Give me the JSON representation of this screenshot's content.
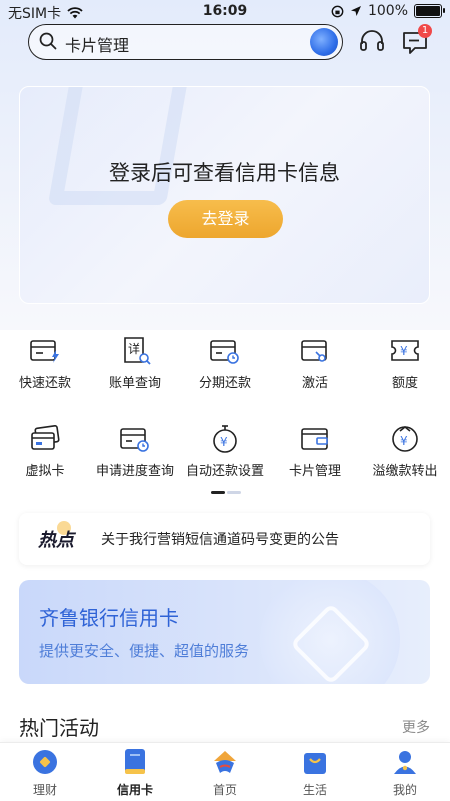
{
  "status_bar": {
    "carrier": "无SIM卡",
    "time": "16:09",
    "battery": "100%"
  },
  "search": {
    "placeholder_text": "卡片管理"
  },
  "notifications": {
    "badge": "1"
  },
  "login_card": {
    "title": "登录后可查看信用卡信息",
    "button": "去登录"
  },
  "services": [
    {
      "label": "快速还款",
      "icon": "card-bolt-icon"
    },
    {
      "label": "账单查询",
      "icon": "bill-search-icon"
    },
    {
      "label": "分期还款",
      "icon": "card-clock-icon"
    },
    {
      "label": "激活",
      "icon": "card-activate-icon"
    },
    {
      "label": "额度",
      "icon": "yen-ticket-icon"
    },
    {
      "label": "虚拟卡",
      "icon": "virtual-card-icon"
    },
    {
      "label": "申请进度查询",
      "icon": "card-progress-icon"
    },
    {
      "label": "自动还款设置",
      "icon": "yen-timer-icon"
    },
    {
      "label": "卡片管理",
      "icon": "wallet-icon"
    },
    {
      "label": "溢缴款转出",
      "icon": "yen-transfer-icon"
    }
  ],
  "hot": {
    "tag": "热点",
    "text": "关于我行营销短信通道码号变更的公告"
  },
  "banner": {
    "title": "齐鲁银行信用卡",
    "subtitle": "提供更安全、便捷、超值的服务"
  },
  "section": {
    "title": "热门活动",
    "more": "更多"
  },
  "tabbar": [
    {
      "label": "理财",
      "active": false
    },
    {
      "label": "信用卡",
      "active": true
    },
    {
      "label": "首页",
      "active": false
    },
    {
      "label": "生活",
      "active": false
    },
    {
      "label": "我的",
      "active": false
    }
  ],
  "colors": {
    "accent": "#2f63d6",
    "login_button": "#f0aa35",
    "badge": "#f04848"
  }
}
